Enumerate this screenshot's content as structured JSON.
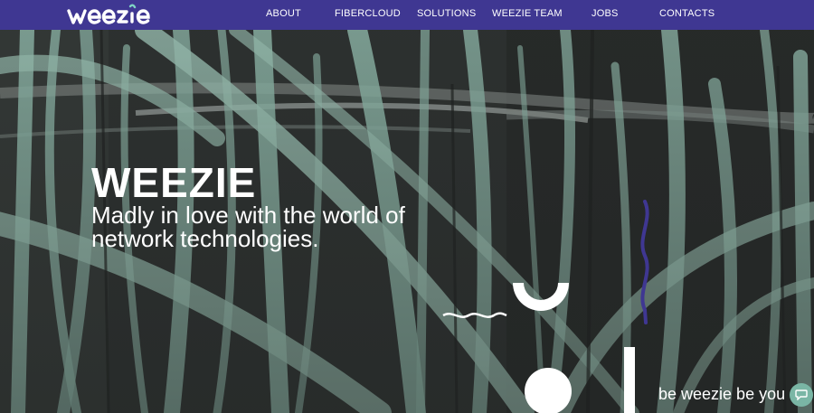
{
  "brand": {
    "logo_text": "weezie",
    "primary_color": "#3f3792",
    "accent_color": "#7fd3c4"
  },
  "nav": {
    "items": [
      {
        "label": "ABOUT"
      },
      {
        "label": "FIBERCLOUD"
      },
      {
        "label": "SOLUTIONS"
      },
      {
        "label": "WEEZIE TEAM"
      },
      {
        "label": "JOBS"
      },
      {
        "label": "CONTACTS"
      }
    ]
  },
  "hero": {
    "title": "WEEZIE",
    "subtitle": "Madly in love with the world of network technologies.",
    "tagline": "be weezie be you",
    "background": "fiber-optic-cables-image"
  },
  "widgets": {
    "chat_icon": "chat-bubble-icon"
  }
}
